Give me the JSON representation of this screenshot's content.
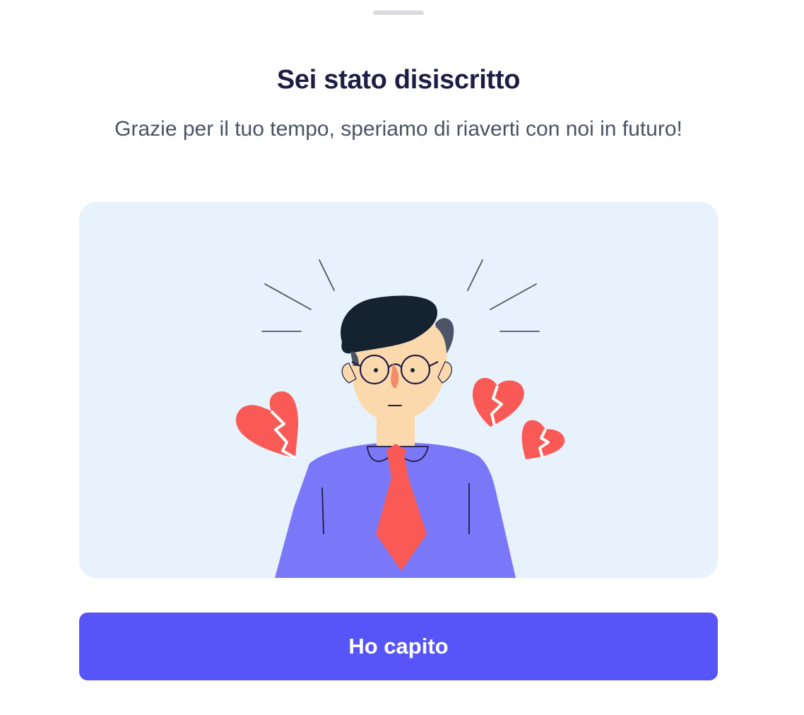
{
  "sheet": {
    "title": "Sei stato disiscritto",
    "subtitle": "Grazie per il tuo tempo, speriamo di riaverti con noi in futuro!",
    "illustration_icon": "sad-man-broken-hearts-illustration",
    "confirm_label": "Ho capito"
  },
  "colors": {
    "accent": "#5755f8",
    "title": "#1f1d45",
    "subtitle": "#4a5263",
    "illustration_bg": "#e8f2fd",
    "heart": "#fa5a55",
    "shirt": "#7a78f8"
  }
}
